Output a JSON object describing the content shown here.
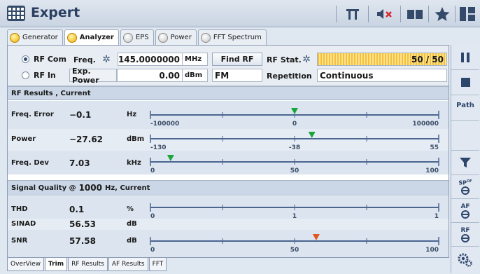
{
  "app": {
    "title": "Expert",
    "app_icon": "grid-menu-icon"
  },
  "toolbar": {
    "icons": [
      "antenna-icon",
      "mute-icon",
      "book-icon",
      "favorite-star-icon",
      "layout-icon"
    ]
  },
  "tabs": [
    {
      "label": "Generator",
      "led": "on"
    },
    {
      "label": "Analyzer",
      "led": "on",
      "active": true
    },
    {
      "label": "EPS",
      "led": "off"
    },
    {
      "label": "Power",
      "led": "off"
    },
    {
      "label": "FFT Spectrum",
      "led": "off"
    }
  ],
  "controls": {
    "rf_com": "RF Com",
    "rf_in": "RF In",
    "selected_input": "RF Com",
    "freq_label": "Freq.",
    "freq_value": "145.0000000",
    "freq_unit": "MHz",
    "find_rf": "Find RF",
    "rf_stat_label": "RF Stat.",
    "rf_stat_value": "50 / 50",
    "rf_stat_fraction": 1.0,
    "exp_power_label": "Exp. Power",
    "exp_power_value": "0.00",
    "exp_power_unit": "dBm",
    "modulation": "FM",
    "repetition_label": "Repetition",
    "repetition_value": "Continuous"
  },
  "rf_results": {
    "header": "RF Results , Current",
    "rows": [
      {
        "label": "Freq. Error",
        "value": "−0.1",
        "unit": "Hz",
        "ticks": [
          "-100000",
          "0",
          "100000"
        ],
        "marker_fraction": 0.5,
        "marker_color": "#1aa53a"
      },
      {
        "label": "Power",
        "value": "−27.62",
        "unit": "dBm",
        "ticks": [
          "-130",
          "-38",
          "55"
        ],
        "marker_fraction": 0.56,
        "marker_color": "#1aa53a"
      },
      {
        "label": "Freq. Dev",
        "value": "7.03",
        "unit": "kHz",
        "ticks": [
          "0",
          "50",
          "100"
        ],
        "marker_fraction": 0.07,
        "marker_color": "#1aa53a"
      }
    ]
  },
  "signal_quality": {
    "header_prefix": "Signal Quality @",
    "header_value": "1000",
    "header_suffix": "Hz, Current",
    "rows": [
      {
        "label": "THD",
        "value": "0.1",
        "unit": "%",
        "ticks": [
          "0",
          "1",
          "1"
        ]
      },
      {
        "label": "SINAD",
        "value": "56.53",
        "unit": "dB"
      },
      {
        "label": "SNR",
        "value": "57.58",
        "unit": "dB",
        "ticks": [
          "0",
          "50",
          "100"
        ],
        "marker_fraction": 0.575,
        "marker_color": "#e0561c"
      }
    ]
  },
  "bottom_tabs": [
    "OverView",
    "Trim",
    "RF Results",
    "AF Results",
    "FFT"
  ],
  "bottom_active": "Trim",
  "side": {
    "path": "Path",
    "sp_label": "SP",
    "sp_sub": "OF",
    "af": "AF",
    "rf": "RF"
  }
}
